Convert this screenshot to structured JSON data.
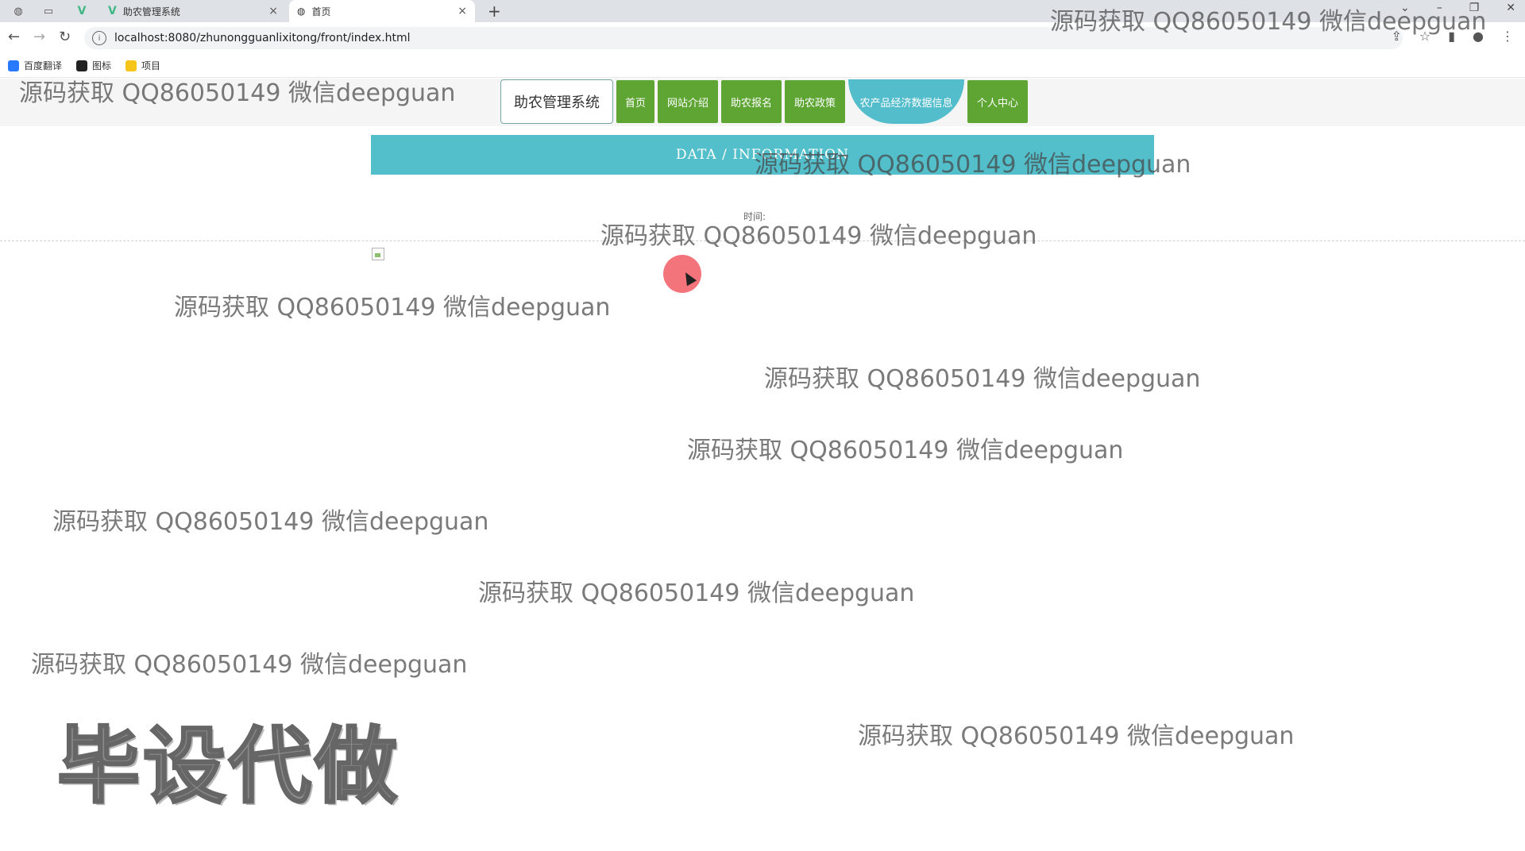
{
  "browser": {
    "tabs": [
      {
        "title": "助农管理系统",
        "close": "×"
      },
      {
        "title": "首页",
        "close": "×"
      }
    ],
    "new_tab": "+",
    "url": "localhost:8080/zhunongguanlixitong/front/index.html",
    "bookmarks": [
      {
        "label": "百度翻译",
        "icon": "translate-icon",
        "color": "#2979ff"
      },
      {
        "label": "图标",
        "icon": "image-icon",
        "color": "#222222"
      },
      {
        "label": "项目",
        "icon": "folder-icon",
        "color": "#f5c518"
      }
    ]
  },
  "page": {
    "site_title": "助农管理系统",
    "nav": [
      {
        "label": "首页"
      },
      {
        "label": "网站介绍"
      },
      {
        "label": "助农报名"
      },
      {
        "label": "助农政策"
      },
      {
        "label": "农产品经济数据信息",
        "active": true
      },
      {
        "label": "个人中心"
      }
    ],
    "banner": "DATA / INFORMATION",
    "time_label": "时间:",
    "colors": {
      "nav_green": "#5ea533",
      "accent_teal": "#53bfcb"
    }
  },
  "watermarks": {
    "text": "源码获取 QQ86050149 微信deepguan",
    "big_text": "毕设代做"
  }
}
